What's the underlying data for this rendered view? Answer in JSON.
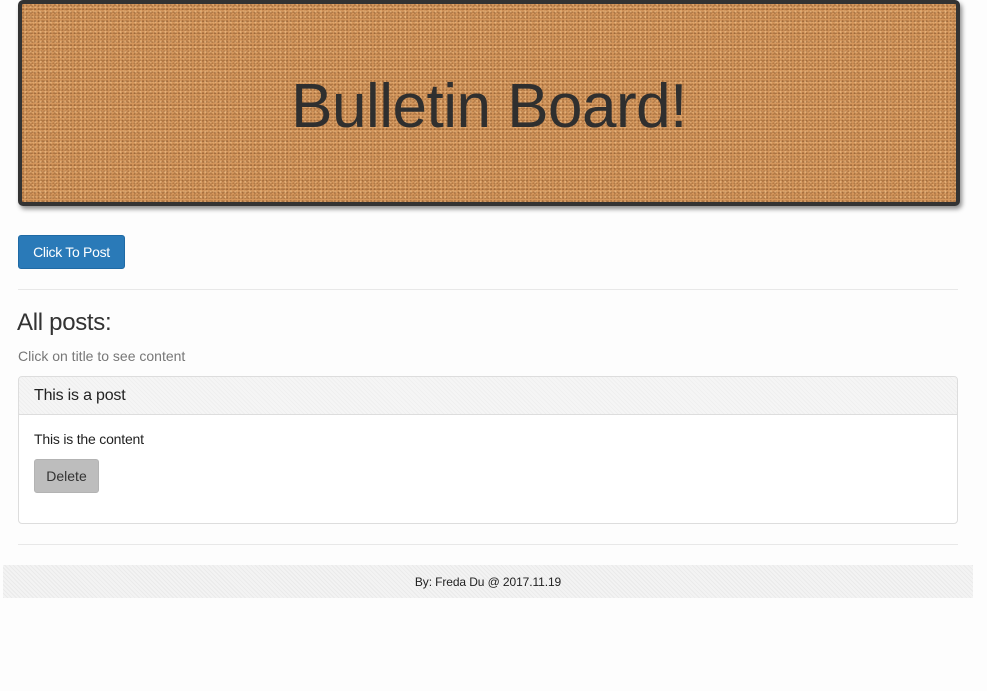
{
  "banner": {
    "title": "Bulletin Board!"
  },
  "actions": {
    "post_label": "Click To Post"
  },
  "posts_section": {
    "title": "All posts:",
    "hint": "Click on title to see content",
    "posts": [
      {
        "title": "This is a post",
        "content": "This is the content",
        "delete_label": "Delete"
      }
    ]
  },
  "footer": {
    "text": "By: Freda Du @ 2017.11.19"
  },
  "colors": {
    "primary_button": "#2a7ab8",
    "cork": "#d4965c",
    "banner_border": "#333333",
    "delete_button": "#bdbdbd"
  }
}
